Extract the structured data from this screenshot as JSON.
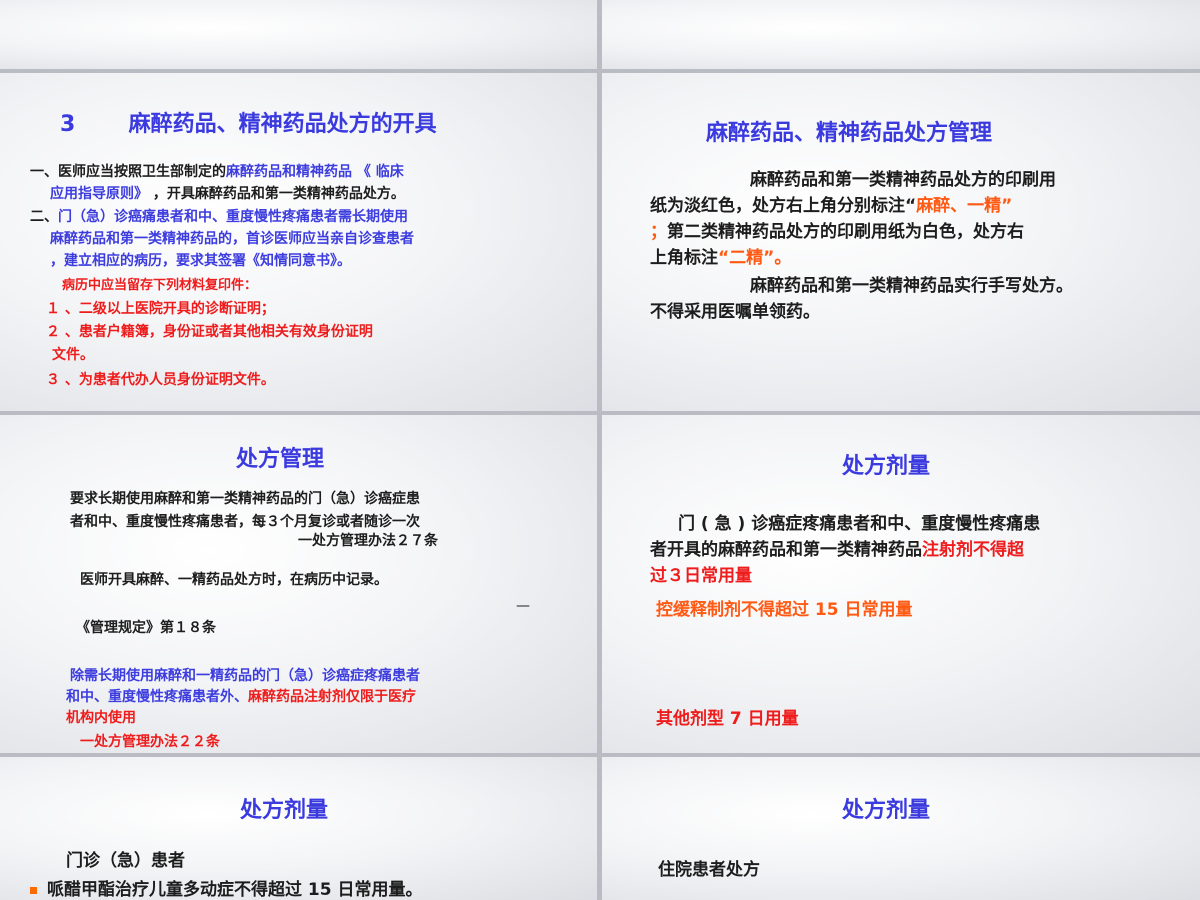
{
  "s3": {
    "title_num": "3",
    "title_text": "麻醉药品、精神药品处方的开具",
    "l1a": "一、医师应当按照卫生部制定的",
    "l1b": "麻醉药品和精神药品 《 临床",
    "l2a": "应用指导原则》",
    "l2b": " ，开具麻醉药品和第一类精神药品处方。",
    "l3a": "二、",
    "l3b": "门（急）诊癌痛患者和中、重度慢性疼痛患者需长期使用",
    "l4": "麻醉药品和第一类精神药品的，首诊医师应当亲自诊查患者",
    "l5": "，建立相应的病历，要求其签署《知情同意书》。",
    "l6": "病历中应当留存下列材料复印件：",
    "l7": "１ 、二级以上医院开具的诊断证明；",
    "l8": "２ 、患者户籍簿，身份证或者其他相关有效身份证明",
    "l9": "文件。",
    "l10": "３ 、为患者代办人员身份证明文件。"
  },
  "s4": {
    "title": "麻醉药品、精神药品处方管理",
    "p1a": "麻醉药品和第一类精神药品处方的印刷用",
    "p1b": "纸为淡红色，处方右上角分别标注“",
    "p1c": "麻醉、一精”",
    "p1d": "；",
    "p1e": "第二类精神药品处方的印刷用纸为白色，处方右",
    "p1f": "上角标注",
    "p1g": "“二精”。",
    "p2a": "麻醉药品和第一类精神药品实行手写处方。",
    "p2b": "不得采用医嘱单领药。"
  },
  "s5": {
    "title": "处方管理",
    "a1": "要求长期使用麻醉和第一类精神药品的门（急）诊癌症患",
    "a2": "者和中、重度慢性疼痛患者，每３个月复诊或者随诊一次",
    "a3": "一处方管理办法２７条",
    "b1": "医师开具麻醉、一精药品处方时，在病历中记录。",
    "dash": "—",
    "b2": "《管理规定》第１８条",
    "c1": "除需长期使用麻醉和一精药品的门（急）诊癌症疼痛患者",
    "c2a": "和中、重度慢性疼痛患者外、",
    "c2b": "麻醉药品注射剂仅限于医疗",
    "c3": "机构内使用",
    "c4": "一处方管理办法２２条"
  },
  "s6": {
    "title": "处方剂量",
    "p1": "门 ( 急 ) 诊癌症疼痛患者和中、重度慢性疼痛患",
    "p2a": "者开具的麻醉药品和第一类精神药品",
    "p2b": "注射剂不得超",
    "p3": "过３日常用量",
    "p4": "控缓释制剂不得超过 15 日常用量",
    "p5": "其他剂型 7 日用量"
  },
  "s7": {
    "title": "处方剂量",
    "sub": "门诊（急）患者",
    "bullet": "哌醋甲酯治疗儿童多动症不得超过 15 日常用量。"
  },
  "s8": {
    "title": "处方剂量",
    "sub": "住院患者处方"
  }
}
